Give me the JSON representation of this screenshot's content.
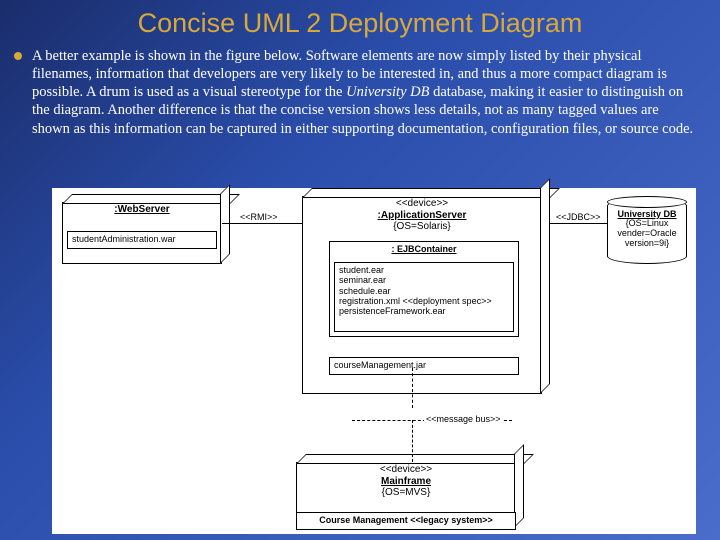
{
  "title": "Concise UML 2 Deployment Diagram",
  "bullet": {
    "text_a": "A better example is shown in the figure below. Software elements are now simply listed by their physical filenames, information that developers are very likely to be interested in, and thus a more compact diagram is possible.   A drum is used as a visual stereotype for the ",
    "italic": "University DB",
    "text_b": " database, making it easier to distinguish on the diagram. Another difference is that the concise version shows less details, not as many tagged values are shown as this information can be captured in either supporting documentation, configuration files, or source code."
  },
  "nodes": {
    "web": {
      "name": ":WebServer"
    },
    "web_artifact": "studentAdministration.war",
    "app": {
      "stereo": "<<device>>",
      "name": ":ApplicationServer",
      "tags": "{OS=Solaris}"
    },
    "ejb": {
      "name": ": EJBContainer",
      "files": [
        "student.ear",
        "seminar.ear",
        "schedule.ear",
        "registration.xml <<deployment spec>>",
        "persistenceFramework.ear"
      ]
    },
    "jar": "courseManagement.jar",
    "db": {
      "name": "University DB",
      "tags": "{OS=Linux vender=Oracle version=9i}"
    },
    "mf": {
      "stereo": "<<device>>",
      "name": "Mainframe",
      "tags": "{OS=MVS}"
    },
    "mf_inner": "Course Management <<legacy system>>"
  },
  "edges": {
    "rmi": "<<RMI>>",
    "jdbc": "<<JDBC>>",
    "bus": "<<message bus>>"
  }
}
